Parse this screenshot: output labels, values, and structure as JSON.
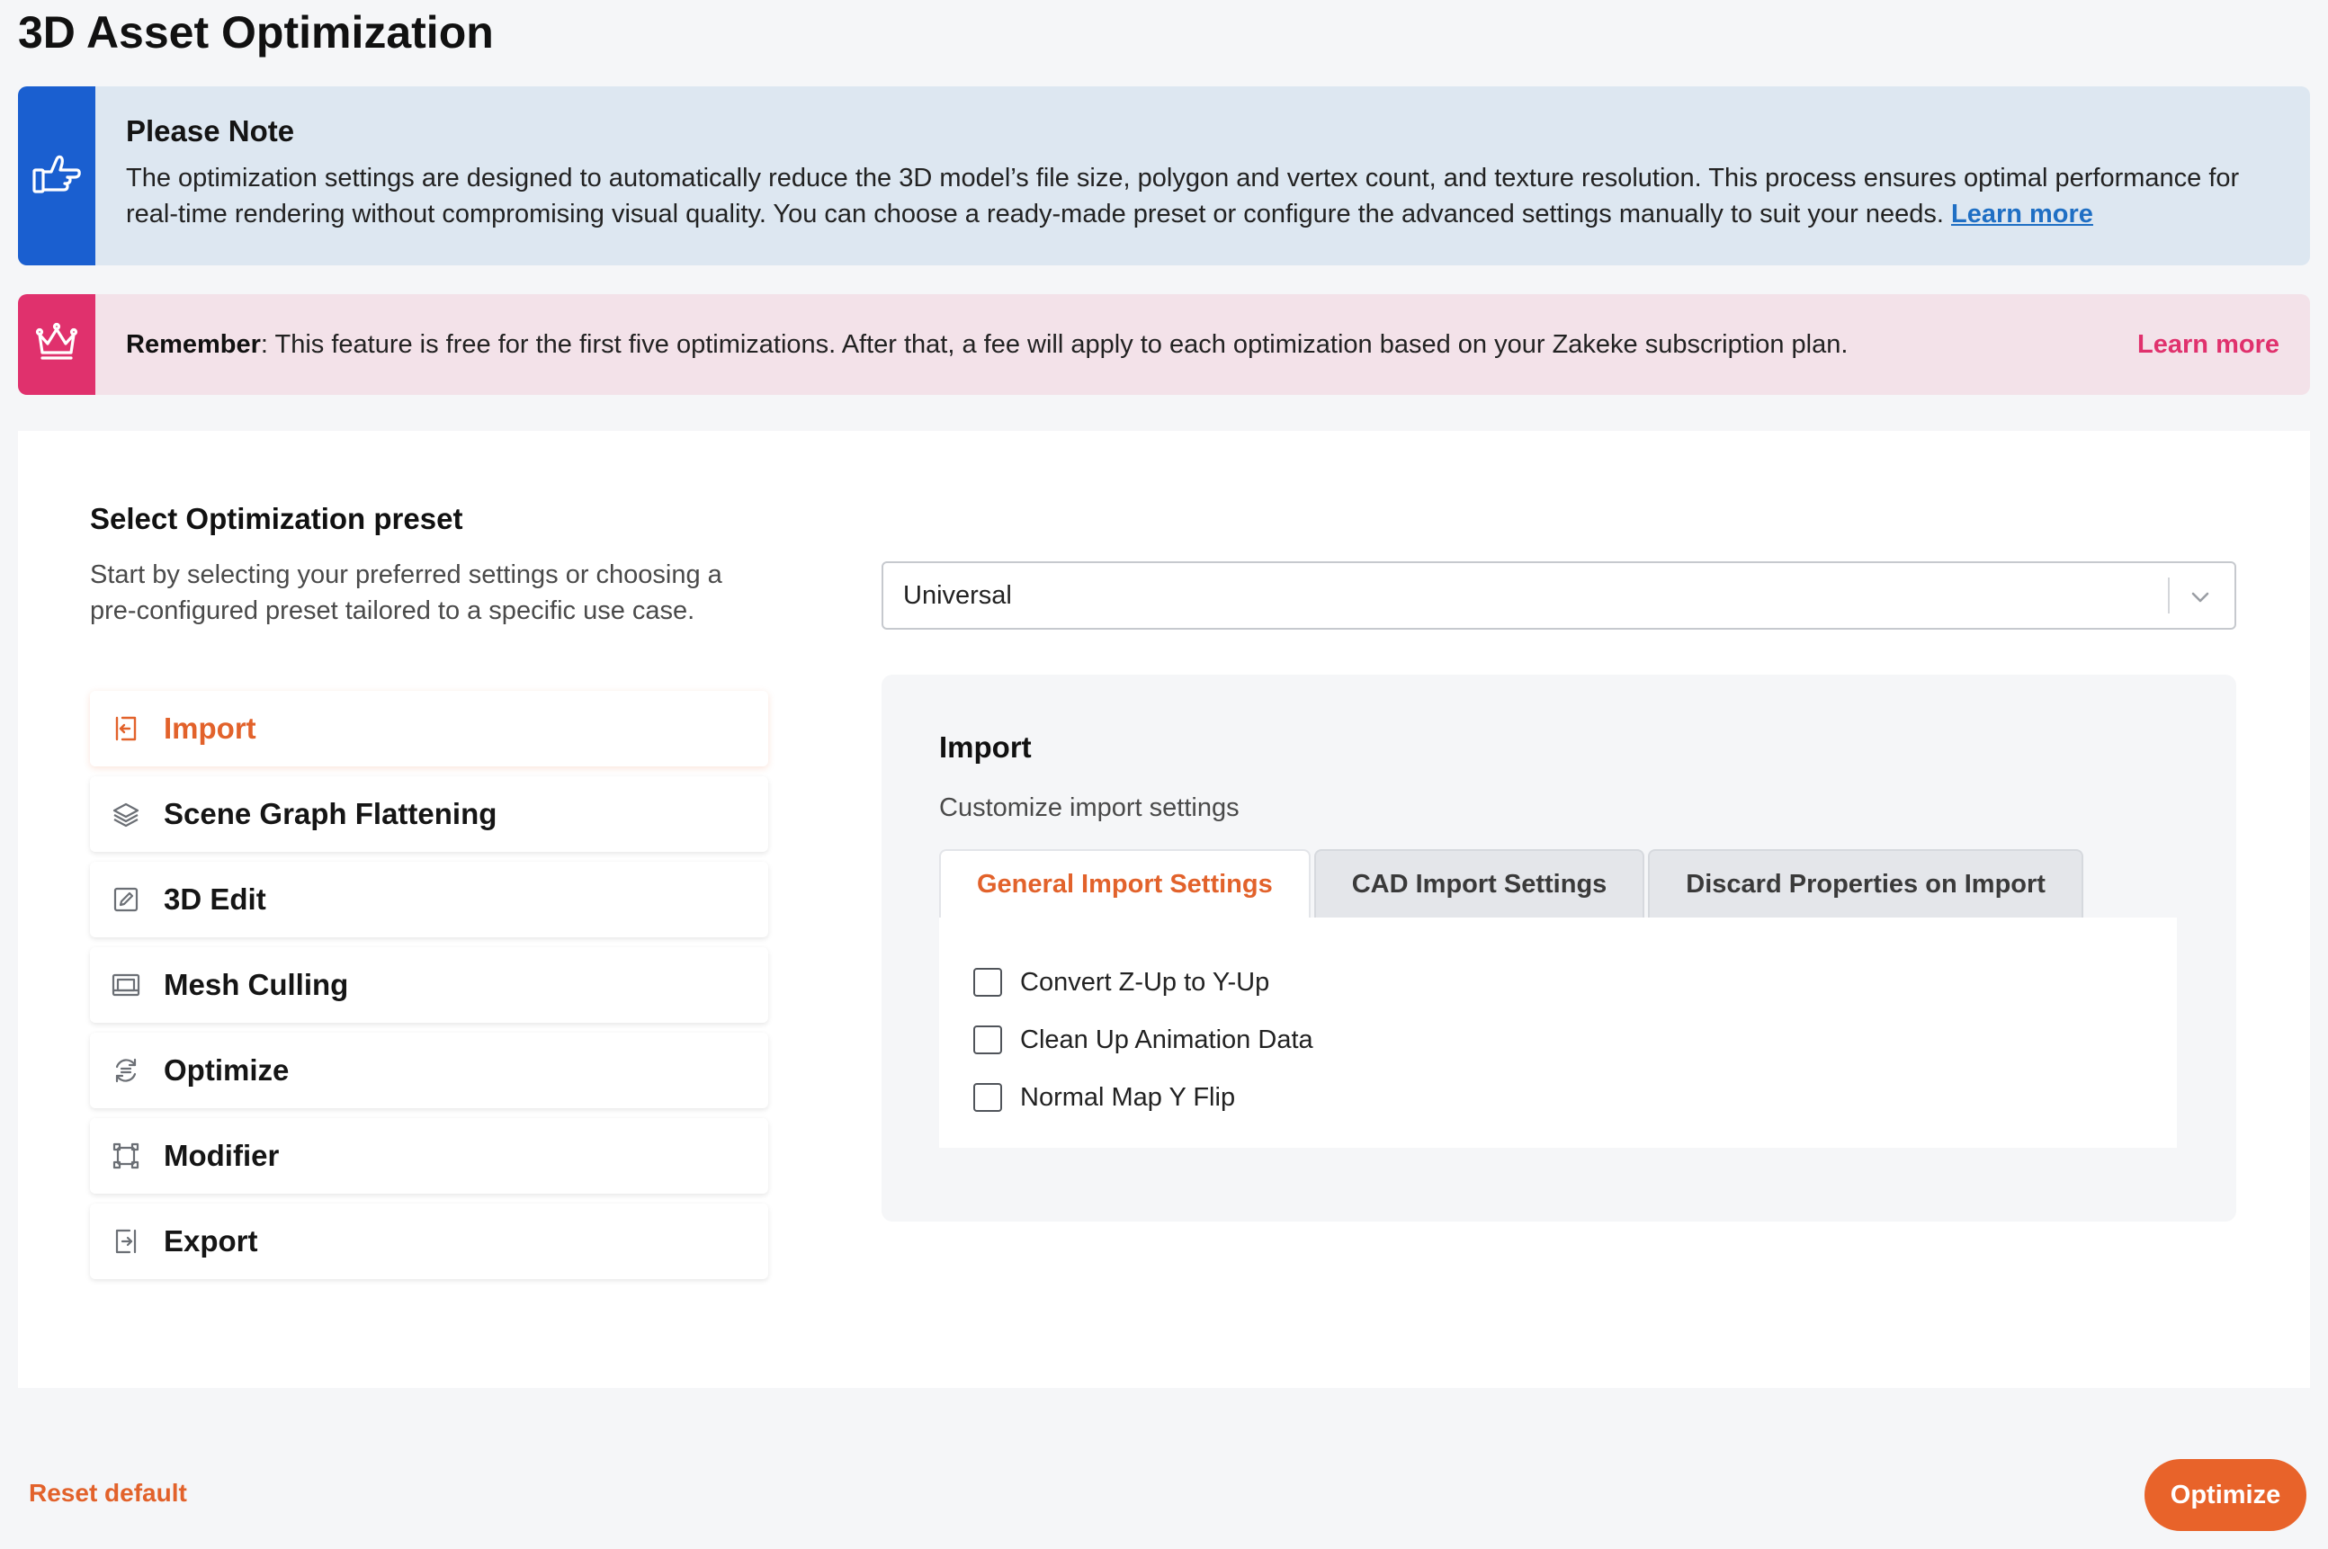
{
  "page": {
    "title": "3D Asset Optimization"
  },
  "notice_info": {
    "title": "Please Note",
    "text": "The optimization settings are designed to automatically reduce the 3D model’s file size, polygon and vertex count, and texture resolution. This process ensures optimal performance for real-time rendering without compromising visual quality. You can choose a ready-made preset or configure the advanced settings manually to suit your needs.",
    "link": "Learn more",
    "icon": "thumbs-up-pointing-icon",
    "color": "#1a5fd0"
  },
  "notice_warn": {
    "label": "Remember",
    "text": ": This feature is free for the first five optimizations. After that, a fee will apply to each optimization based on your Zakeke subscription plan.",
    "link": "Learn more",
    "icon": "crown-icon",
    "color": "#e0316d"
  },
  "preset": {
    "title": "Select Optimization preset",
    "description": "Start by selecting your preferred settings or choosing a pre-configured preset tailored to a specific use case.",
    "selected": "Universal"
  },
  "menu": {
    "items": [
      {
        "label": "Import",
        "icon": "import-icon",
        "active": true
      },
      {
        "label": "Scene Graph Flattening",
        "icon": "layers-icon",
        "active": false
      },
      {
        "label": "3D Edit",
        "icon": "edit-icon",
        "active": false
      },
      {
        "label": "Mesh Culling",
        "icon": "mesh-culling-icon",
        "active": false
      },
      {
        "label": "Optimize",
        "icon": "optimize-icon",
        "active": false
      },
      {
        "label": "Modifier",
        "icon": "modifier-icon",
        "active": false
      },
      {
        "label": "Export",
        "icon": "export-icon",
        "active": false
      }
    ]
  },
  "panel": {
    "title": "Import",
    "description": "Customize import settings",
    "tabs": [
      {
        "label": "General Import Settings",
        "active": true
      },
      {
        "label": "CAD Import Settings",
        "active": false
      },
      {
        "label": "Discard Properties on Import",
        "active": false
      }
    ],
    "options": [
      {
        "label": "Convert Z-Up to Y-Up",
        "checked": false
      },
      {
        "label": "Clean Up Animation Data",
        "checked": false
      },
      {
        "label": "Normal Map Y Flip",
        "checked": false
      }
    ]
  },
  "footer": {
    "reset_label": "Reset default",
    "optimize_label": "Optimize"
  },
  "colors": {
    "accent": "#e2622b",
    "info": "#1a5fd0",
    "warning": "#e0316d"
  }
}
